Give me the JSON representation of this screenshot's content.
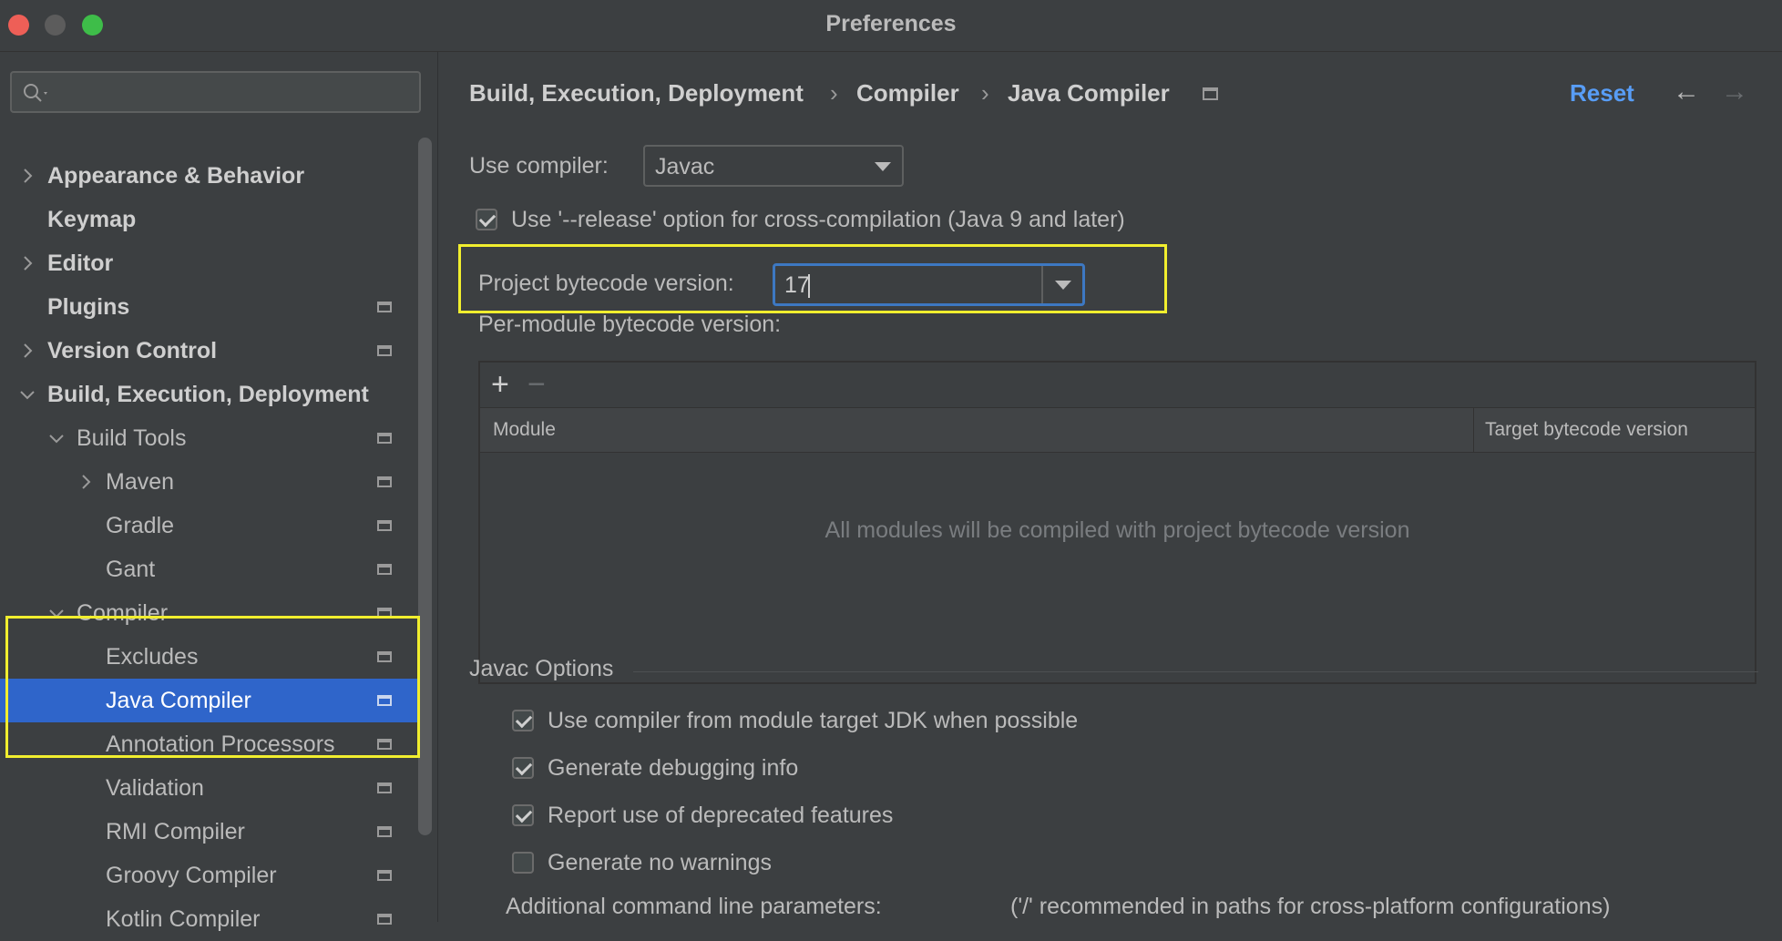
{
  "window": {
    "title": "Preferences"
  },
  "search": {
    "placeholder": ""
  },
  "sidebar": {
    "items": [
      {
        "label": "Appearance & Behavior",
        "arrow": "right"
      },
      {
        "label": "Keymap"
      },
      {
        "label": "Editor",
        "arrow": "right"
      },
      {
        "label": "Plugins"
      },
      {
        "label": "Version Control",
        "arrow": "right"
      },
      {
        "label": "Build, Execution, Deployment",
        "arrow": "down"
      },
      {
        "label": "Build Tools",
        "arrow": "down"
      },
      {
        "label": "Maven",
        "arrow": "right"
      },
      {
        "label": "Gradle"
      },
      {
        "label": "Gant"
      },
      {
        "label": "Compiler",
        "arrow": "down"
      },
      {
        "label": "Excludes"
      },
      {
        "label": "Java Compiler",
        "selected": true
      },
      {
        "label": "Annotation Processors"
      },
      {
        "label": "Validation"
      },
      {
        "label": "RMI Compiler"
      },
      {
        "label": "Groovy Compiler"
      },
      {
        "label": "Kotlin Compiler"
      }
    ]
  },
  "breadcrumb": {
    "items": [
      "Build, Execution, Deployment",
      "Compiler",
      "Java Compiler"
    ],
    "separator": "›"
  },
  "header": {
    "reset_label": "Reset",
    "back_icon": "←",
    "forward_icon": "→"
  },
  "compiler": {
    "use_compiler_label": "Use compiler:",
    "use_compiler_value": "Javac",
    "release_option_label": "Use '--release' option for cross-compilation (Java 9 and later)",
    "release_option_checked": true,
    "project_bytecode_label": "Project bytecode version:",
    "project_bytecode_value": "17",
    "per_module_label": "Per-module bytecode version:"
  },
  "module_table": {
    "add_icon": "+",
    "remove_icon": "−",
    "columns": [
      "Module",
      "Target bytecode version"
    ],
    "empty_text": "All modules will be compiled with project bytecode version"
  },
  "javac_options": {
    "title": "Javac Options",
    "checkboxes": [
      {
        "label": "Use compiler from module target JDK when possible",
        "checked": true
      },
      {
        "label": "Generate debugging info",
        "checked": true
      },
      {
        "label": "Report use of deprecated features",
        "checked": true
      },
      {
        "label": "Generate no warnings",
        "checked": false
      }
    ],
    "additional_params_label": "Additional command line parameters:",
    "additional_params_hint": "('/' recommended in paths for cross-platform configurations)"
  },
  "colors": {
    "background": "#3c3f41",
    "selection": "#2f65ca",
    "link": "#589df6",
    "highlight": "#f1ee2e",
    "focus": "#3d78c2"
  }
}
